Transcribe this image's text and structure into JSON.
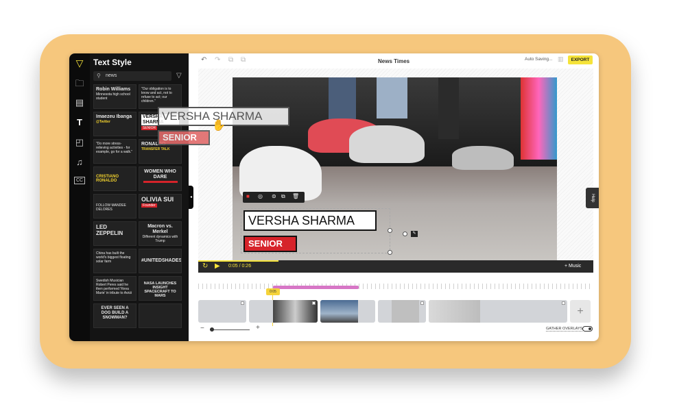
{
  "sidebar": {
    "logo": "logo-icon",
    "items": [
      {
        "icon": "folder-upload-icon"
      },
      {
        "icon": "media-icon"
      },
      {
        "icon": "text-style-icon"
      },
      {
        "icon": "shapes-icon"
      },
      {
        "icon": "music-icon"
      },
      {
        "icon": "captions-icon"
      }
    ]
  },
  "panel": {
    "title": "Text Style",
    "search_value": "news",
    "tiles": [
      {
        "t1": "Robin Williams",
        "t2": "Minnesota high school student"
      },
      {
        "t1": "\"Our obligation is to know and act, not to refuse to act; our children.\"",
        "t2": ""
      },
      {
        "t1": "Imaezeu Ibanga",
        "t2": "@Twitter"
      },
      {
        "t1": "VERSHA SHARMA",
        "t2": "SENIOR"
      },
      {
        "t1": "\"Do more stress-relieving activities - for example, go for a walk.\"",
        "t2": ""
      },
      {
        "t1": "RONALDO",
        "t2": "TRANSFER TALK"
      },
      {
        "t1": "CRISTIANO RONALDO",
        "t2": ""
      },
      {
        "t1": "WOMEN WHO DARE",
        "t2": ""
      },
      {
        "t1": "FOLLOW MANDEE DELORES",
        "t2": ""
      },
      {
        "t1": "OLIVIA SUI",
        "t2": "Founder"
      },
      {
        "t1": "LED ZEPPELIN",
        "t2": ""
      },
      {
        "t1": "Macron vs. Merkel",
        "t2": "Different dynamics with Trump"
      },
      {
        "t1": "China has built the world's biggest floating solar farm",
        "t2": ""
      },
      {
        "t1": "#UNITEDSHADES",
        "t2": ""
      },
      {
        "t1": "Swedish Musician Robert Peres said he then performed 'Reva Marie' in tribute to Avicii",
        "t2": ""
      },
      {
        "t1": "NASA LAUNCHES INSIGHT SPACECRAFT TO MARS",
        "t2": ""
      },
      {
        "t1": "EVER SEEN A DOG BUILD A SNOWMAN?",
        "t2": ""
      },
      {
        "t1": "",
        "t2": ""
      }
    ]
  },
  "toolbar": {
    "undo": "undo-icon",
    "redo": "redo-icon",
    "title": "News Times",
    "autosave": "Auto Saving...",
    "export_label": "EXPORT"
  },
  "overlay": {
    "name": "VERSHA SHARMA",
    "title": "SENIOR"
  },
  "drag_preview": {
    "name": "VERSHA SHARMA",
    "title": "SENIOR"
  },
  "player": {
    "time": "0:05 / 0:26",
    "music_label": "+ Music",
    "progress": 0.2
  },
  "timeline": {
    "playhead_label": "0:05",
    "gather_label": "GATHER OVERLAYS"
  },
  "help_label": "Help"
}
